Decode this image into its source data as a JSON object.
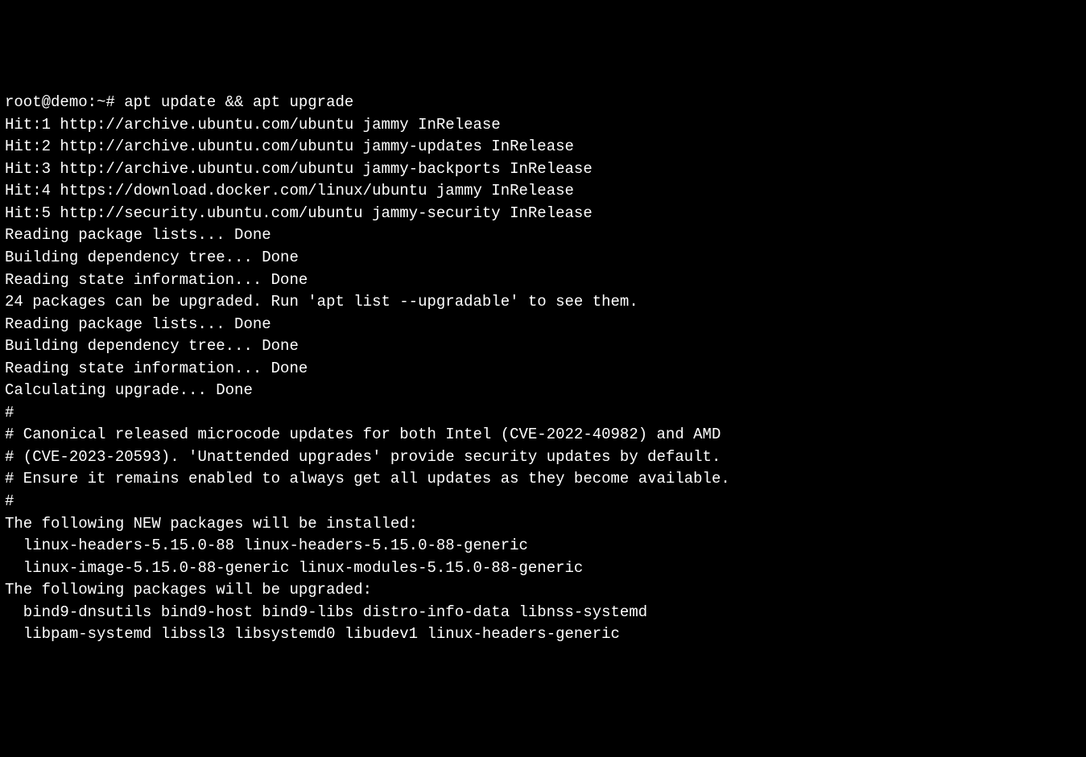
{
  "terminal": {
    "prompt": "root@demo:~# ",
    "command": "apt update && apt upgrade",
    "lines": [
      "Hit:1 http://archive.ubuntu.com/ubuntu jammy InRelease",
      "Hit:2 http://archive.ubuntu.com/ubuntu jammy-updates InRelease",
      "Hit:3 http://archive.ubuntu.com/ubuntu jammy-backports InRelease",
      "Hit:4 https://download.docker.com/linux/ubuntu jammy InRelease",
      "Hit:5 http://security.ubuntu.com/ubuntu jammy-security InRelease",
      "Reading package lists... Done",
      "Building dependency tree... Done",
      "Reading state information... Done",
      "24 packages can be upgraded. Run 'apt list --upgradable' to see them.",
      "Reading package lists... Done",
      "Building dependency tree... Done",
      "Reading state information... Done",
      "Calculating upgrade... Done",
      "#",
      "# Canonical released microcode updates for both Intel (CVE-2022-40982) and AMD",
      "# (CVE-2023-20593). 'Unattended upgrades' provide security updates by default.",
      "# Ensure it remains enabled to always get all updates as they become available.",
      "#",
      "The following NEW packages will be installed:",
      "  linux-headers-5.15.0-88 linux-headers-5.15.0-88-generic",
      "  linux-image-5.15.0-88-generic linux-modules-5.15.0-88-generic",
      "The following packages will be upgraded:",
      "  bind9-dnsutils bind9-host bind9-libs distro-info-data libnss-systemd",
      "  libpam-systemd libssl3 libsystemd0 libudev1 linux-headers-generic"
    ]
  }
}
